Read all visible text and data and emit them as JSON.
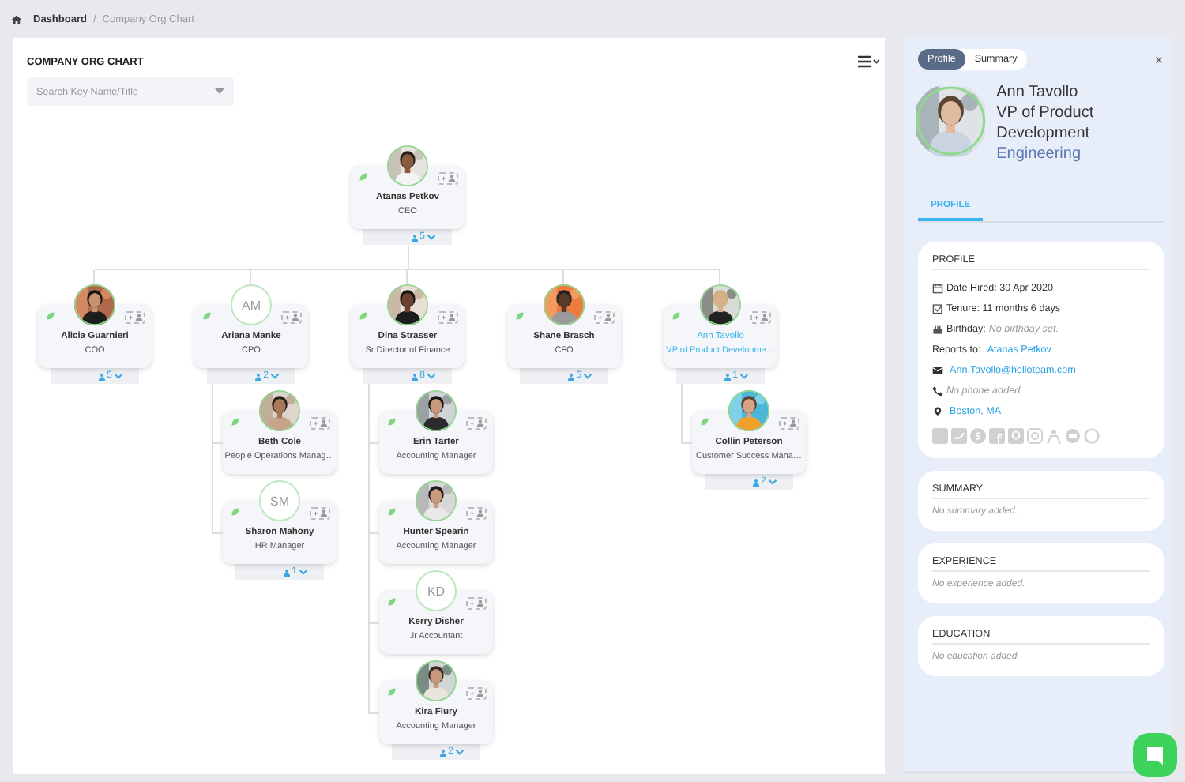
{
  "breadcrumb": {
    "items": [
      {
        "label": "Dashboard",
        "current": false
      },
      {
        "label": "Company Org Chart",
        "current": true
      }
    ],
    "separator": "/"
  },
  "chart": {
    "title": "COMPANY ORG CHART",
    "search": {
      "placeholder": "Search Key Name/Title"
    },
    "root": {
      "name": "Atanas Petkov",
      "title": "CEO",
      "reports": "5",
      "selected": false,
      "children": [
        {
          "name": "Alicia Guarnieri",
          "title": "COO",
          "reports": "5",
          "selected": false
        },
        {
          "name": "Ariana Manke",
          "title": "CPO",
          "kind": "initials",
          "initials": "AM",
          "reports": "2",
          "selected": false,
          "children": [
            {
              "name": "Beth Cole",
              "title": "People Operations Manag…",
              "selected": false
            },
            {
              "name": "Sharon Mahony",
              "title": "HR Manager",
              "kind": "initials",
              "initials": "SM",
              "reports": "1",
              "selected": false
            }
          ]
        },
        {
          "name": "Dina Strasser",
          "title": "Sr Director of Finance",
          "reports": "8",
          "selected": false,
          "children": [
            {
              "name": "Erin Tarter",
              "title": "Accounting Manager",
              "selected": false
            },
            {
              "name": "Hunter Spearin",
              "title": "Accounting Manager",
              "selected": false
            },
            {
              "name": "Kerry Disher",
              "title": "Jr Accountant",
              "kind": "initials",
              "initials": "KD",
              "selected": false
            },
            {
              "name": "Kira Flury",
              "title": "Accounting Manager",
              "reports": "2",
              "selected": false
            }
          ]
        },
        {
          "name": "Shane Brasch",
          "title": "CFO",
          "reports": "5",
          "selected": false
        },
        {
          "name": "Ann Tavollo",
          "title": "VP of Product Developme…",
          "reports": "1",
          "selected": true,
          "children": [
            {
              "name": "Collin Peterson",
              "title": "Customer Success Mana…",
              "reports": "2",
              "selected": false
            }
          ]
        }
      ]
    }
  },
  "profile_panel": {
    "tabs": [
      {
        "label": "Profile",
        "selected": true
      },
      {
        "label": "Summary",
        "selected": false
      }
    ],
    "close": "×",
    "name": "Ann Tavollo",
    "title": "VP of Product Development",
    "department": "Engineering",
    "section_tabs": [
      {
        "label": "PROFILE",
        "selected": true
      }
    ],
    "profile_card": {
      "heading": "PROFILE",
      "rows": [
        {
          "kind": "calendar",
          "text": "Date Hired: 30 Apr 2020"
        },
        {
          "kind": "check",
          "text": "Tenure: 11 months 6 days"
        },
        {
          "kind": "cake",
          "text": "Birthday:",
          "note": "No birthday set."
        },
        {
          "kind": "reports",
          "text": "Reports to:",
          "link": "Atanas Petkov"
        },
        {
          "kind": "mail",
          "link": "Ann.Tavollo@helloteam.com"
        },
        {
          "kind": "phone",
          "note": "No phone added."
        },
        {
          "kind": "pin",
          "link": "Boston, MA"
        }
      ]
    },
    "sections": [
      {
        "heading": "SUMMARY",
        "note": "No summary added."
      },
      {
        "heading": "EXPERIENCE",
        "note": "No experience added."
      },
      {
        "heading": "EDUCATION",
        "note": "No education added."
      }
    ]
  }
}
